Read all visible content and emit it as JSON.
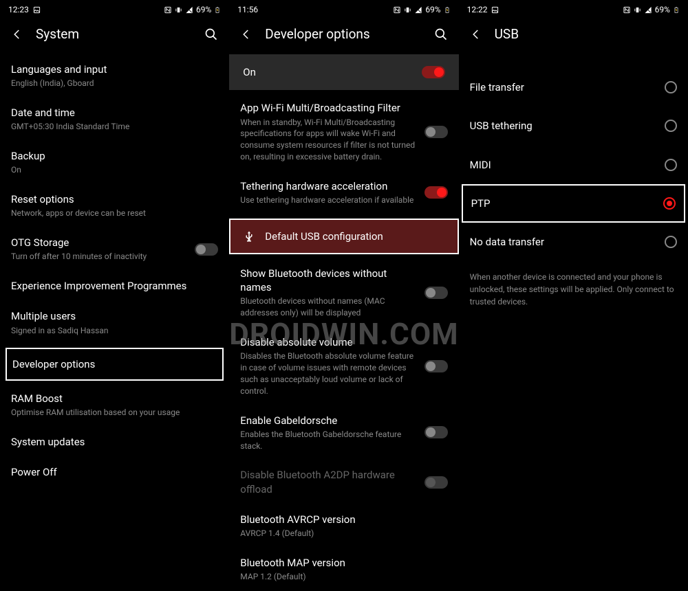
{
  "watermark": "DROIDWIN.COM",
  "panels": [
    {
      "status": {
        "time": "12:23",
        "battery": "69%"
      },
      "header": {
        "title": "System"
      },
      "items": [
        {
          "title": "Languages and input",
          "sub": "English (India), Gboard"
        },
        {
          "title": "Date and time",
          "sub": "GMT+05:30 India Standard Time"
        },
        {
          "title": "Backup",
          "sub": "On"
        },
        {
          "title": "Reset options",
          "sub": "Network, apps or device can be reset"
        },
        {
          "title": "OTG Storage",
          "sub": "Turn off after 10 minutes of inactivity",
          "toggle": "off"
        },
        {
          "title": "Experience Improvement Programmes"
        },
        {
          "title": "Multiple users",
          "sub": "Signed in as Sadiq Hassan"
        },
        {
          "title": "Developer options",
          "highlight": true
        },
        {
          "title": "RAM Boost",
          "sub": "Optimise RAM utilisation based on your usage"
        },
        {
          "title": "System updates"
        },
        {
          "title": "Power Off"
        }
      ]
    },
    {
      "status": {
        "time": "11:56",
        "battery": "69%"
      },
      "header": {
        "title": "Developer options"
      },
      "top_on": {
        "label": "On"
      },
      "items": [
        {
          "title": "App Wi-Fi Multi/Broadcasting Filter",
          "sub": "When in standby, Wi-Fi Multi/Broadcasting specifications for apps will wake Wi-Fi and consume system resources if filter is not turned on, resulting in excessive battery drain.",
          "toggle": "off"
        },
        {
          "title": "Tethering hardware acceleration",
          "sub": "Use tethering hardware acceleration if available",
          "toggle": "on"
        },
        {
          "title": "Default USB configuration",
          "usb_highlight": true
        },
        {
          "title": "Show Bluetooth devices without names",
          "sub": "Bluetooth devices without names (MAC addresses only) will be displayed",
          "toggle": "off"
        },
        {
          "title": "Disable absolute volume",
          "sub": "Disables the Bluetooth absolute volume feature in case of volume issues with remote devices such as unacceptably loud volume or lack of control.",
          "toggle": "off"
        },
        {
          "title": "Enable Gabeldorsche",
          "sub": "Enables the Bluetooth Gabeldorsche feature stack.",
          "toggle": "off"
        },
        {
          "title": "Disable Bluetooth A2DP hardware offload",
          "toggle": "disabled",
          "dim": true
        },
        {
          "title": "Bluetooth AVRCP version",
          "sub": "AVRCP 1.4 (Default)"
        },
        {
          "title": "Bluetooth MAP version",
          "sub": "MAP 1.2 (Default)"
        }
      ]
    },
    {
      "status": {
        "time": "12:22",
        "battery": "69%"
      },
      "header": {
        "title": "USB"
      },
      "options": [
        {
          "label": "File transfer",
          "selected": false
        },
        {
          "label": "USB tethering",
          "selected": false
        },
        {
          "label": "MIDI",
          "selected": false
        },
        {
          "label": "PTP",
          "selected": true,
          "highlight": true
        },
        {
          "label": "No data transfer",
          "selected": false
        }
      ],
      "footnote": "When another device is connected and your phone is unlocked, these settings will be applied. Only connect to trusted devices."
    }
  ]
}
